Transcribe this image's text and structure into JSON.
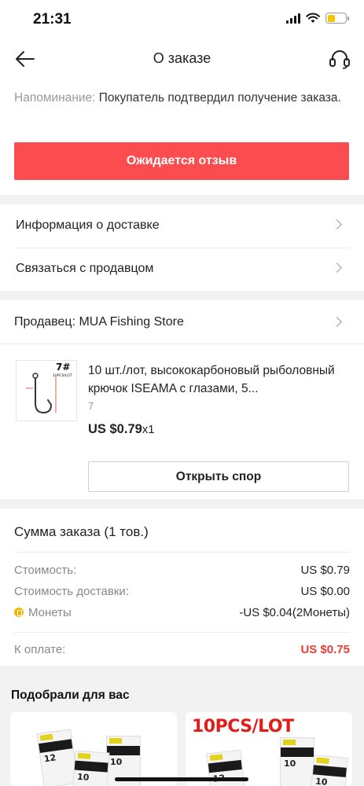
{
  "status_bar": {
    "time": "21:31"
  },
  "header": {
    "title": "О заказе"
  },
  "reminder": {
    "label": "Напоминание:",
    "text": "Покупатель подтвердил получение заказа."
  },
  "review_button": "Ожидается отзыв",
  "links": [
    {
      "label": "Информация о доставке"
    },
    {
      "label": "Связаться с продавцом"
    }
  ],
  "seller": {
    "label": "Продавец: MUA Fishing Store"
  },
  "product": {
    "thumbnail_text": "7#",
    "thumbnail_subtext": "10PCS/LOT",
    "title": "10 шт./лот, высококарбоновый рыболовный крючок ISEAMA с глазами, 5...",
    "variant": "7",
    "price": "US $0.79",
    "quantity": "x1"
  },
  "dispute_button": "Открыть спор",
  "summary": {
    "title": "Сумма заказа (1 тов.)",
    "lines": [
      {
        "label": "Стоимость:",
        "value": "US $0.79"
      },
      {
        "label": "Стоимость доставки:",
        "value": "US $0.00"
      },
      {
        "label": "Монеты",
        "value": "-US $0.04(2Монеты)"
      }
    ],
    "total_label": "К оплате:",
    "total_value": "US $0.75"
  },
  "recommendations": {
    "title": "Подобрали для вас",
    "card_two_text": "10PCS/LOT",
    "pack_numbers": [
      "12",
      "10",
      "10"
    ]
  },
  "colors": {
    "accent": "#fb4d4f",
    "total_red": "#f03a3a",
    "coin": "#f4b400",
    "battery": "#f6c400"
  }
}
